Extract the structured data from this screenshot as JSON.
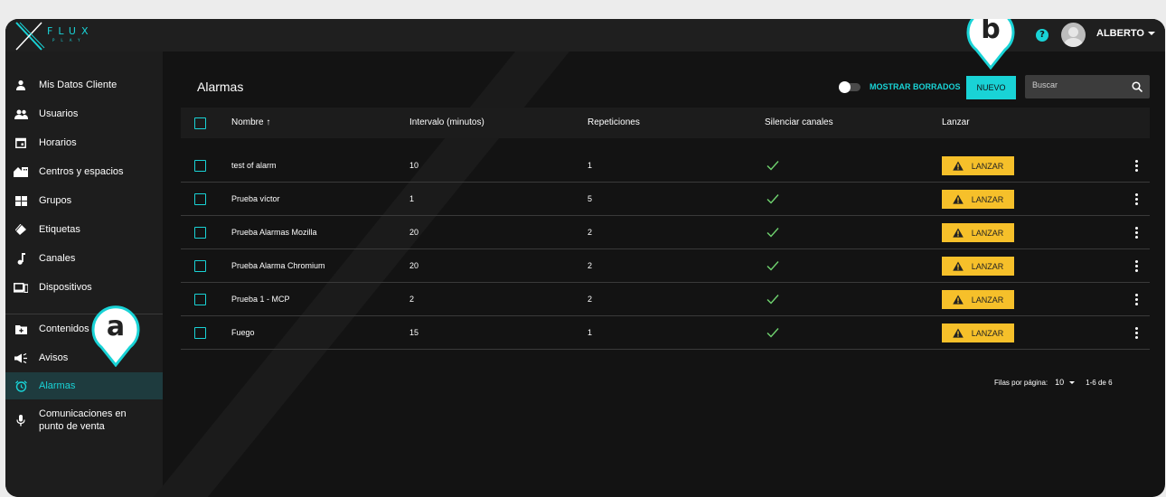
{
  "brand": {
    "name": "FLUX",
    "sub": "PLAY"
  },
  "header": {
    "user": "ALBERTO",
    "help_icon": "question-icon"
  },
  "sidebar": {
    "items": [
      {
        "label": "Mis Datos Cliente",
        "icon": "person-icon"
      },
      {
        "label": "Usuarios",
        "icon": "users-icon"
      },
      {
        "label": "Horarios",
        "icon": "calendar-icon"
      },
      {
        "label": "Centros y espacios",
        "icon": "building-icon"
      },
      {
        "label": "Grupos",
        "icon": "grid-icon"
      },
      {
        "label": "Etiquetas",
        "icon": "tag-icon"
      },
      {
        "label": "Canales",
        "icon": "music-note-icon"
      },
      {
        "label": "Dispositivos",
        "icon": "devices-icon"
      },
      {
        "label": "Contenidos",
        "icon": "folder-icon"
      },
      {
        "label": "Avisos",
        "icon": "megaphone-icon"
      },
      {
        "label": "Alarmas",
        "icon": "alarm-icon"
      },
      {
        "label": "Comunicaciones en",
        "label2": "punto de venta",
        "icon": "mic-icon"
      }
    ],
    "active": "Alarmas"
  },
  "page": {
    "title": "Alarmas",
    "toggle_label": "MOSTRAR BORRADOS",
    "toggle_on": false,
    "new_button": "NUEVO",
    "search_placeholder": "Buscar"
  },
  "table": {
    "columns": [
      "Nombre",
      "Intervalo (minutos)",
      "Repeticiones",
      "Silenciar canales",
      "Lanzar"
    ],
    "sort_indicator": "↑",
    "launch_label": "LANZAR",
    "rows": [
      {
        "name": "test of alarm",
        "interval": "10",
        "repetitions": "1",
        "mute": true
      },
      {
        "name": "Prueba víctor",
        "interval": "1",
        "repetitions": "5",
        "mute": true
      },
      {
        "name": "Prueba Alarmas Mozilla",
        "interval": "20",
        "repetitions": "2",
        "mute": true
      },
      {
        "name": "Prueba Alarma Chromium",
        "interval": "20",
        "repetitions": "2",
        "mute": true
      },
      {
        "name": "Prueba 1 - MCP",
        "interval": "2",
        "repetitions": "2",
        "mute": true
      },
      {
        "name": "Fuego",
        "interval": "15",
        "repetitions": "1",
        "mute": true
      }
    ]
  },
  "pagination": {
    "label": "Filas por página:",
    "per_page": "10",
    "range": "1-6 de 6"
  },
  "markers": {
    "a": "a",
    "b": "b"
  },
  "colors": {
    "accent": "#19d3d6",
    "launch": "#f6c02a",
    "check": "#6fd36f",
    "background": "#131313"
  }
}
